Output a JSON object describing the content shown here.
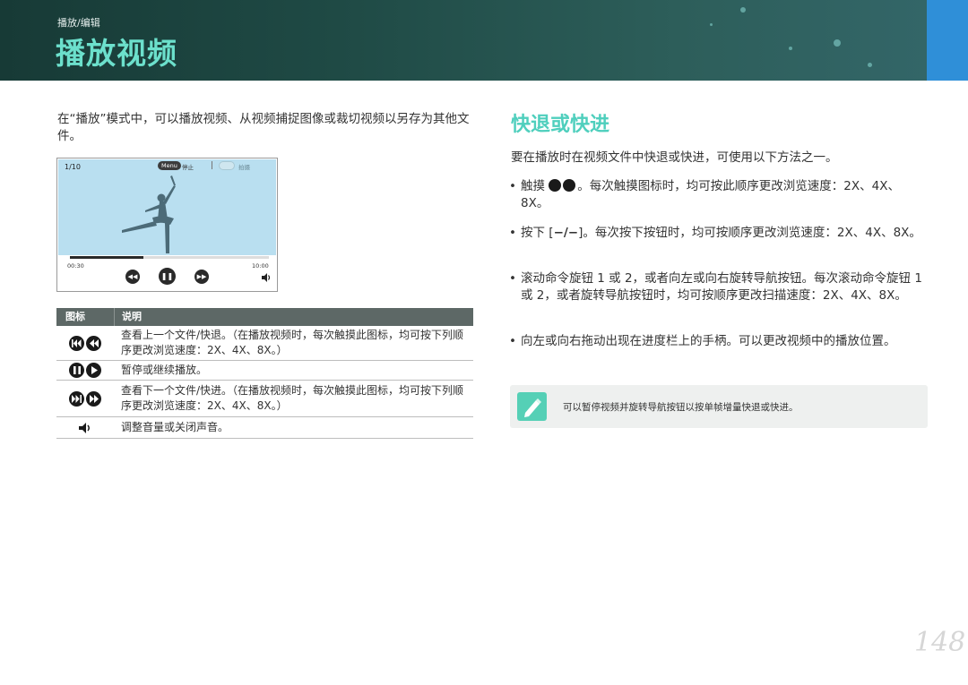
{
  "header": {
    "breadcrumb": "播放/编辑",
    "title": "播放视频"
  },
  "left": {
    "intro": "在“播放”模式中，可以播放视频、从视频捕捉图像或裁切视频以另存为其他文件。",
    "screen": {
      "counter": "1/10",
      "menu_label": "Menu",
      "stop_label": "停止",
      "capture_label": "拍摄",
      "time_start": "00:30",
      "time_end": "10:00",
      "progress": 0.37
    },
    "table": {
      "col_icon": "图标",
      "col_desc": "说明",
      "rows": [
        {
          "icons": [
            "skip-back-icon",
            "rewind-icon"
          ],
          "desc": "查看上一个文件/快退。（在播放视频时，每次触摸此图标，均可按下列顺序更改浏览速度：2X、4X、8X。）"
        },
        {
          "icons": [
            "pause-icon",
            "play-icon"
          ],
          "desc": "暂停或继续播放。"
        },
        {
          "icons": [
            "skip-forward-icon",
            "fast-forward-icon"
          ],
          "desc": "查看下一个文件/快进。（在播放视频时，每次触摸此图标，均可按下列顺序更改浏览速度：2X、4X、8X。）"
        },
        {
          "icons": [
            "volume-icon"
          ],
          "desc": "调整音量或关闭声音。"
        }
      ]
    }
  },
  "right": {
    "title": "快退或快进",
    "intro": "要在播放时在视频文件中快退或快进，可使用以下方法之一。",
    "bullets": [
      {
        "pre": "触摸",
        "post": "。每次触摸图标时，均可按此顺序更改浏览速度：2X、4X、8X。"
      },
      {
        "pre": "按下 [",
        "key": "−/−",
        "post": "]。每次按下按钮时，均可按顺序更改浏览速度：2X、4X、8X。"
      },
      {
        "text": "滚动命令旋钮 1 或 2，或者向左或向右旋转导航按钮。每次滚动命令旋钮 1 或 2，或者旋转导航按钮时，均可按顺序更改扫描速度：2X、4X、8X。"
      },
      {
        "text": "向左或向右拖动出现在进度栏上的手柄。可以更改视频中的播放位置。"
      }
    ],
    "note": "可以暂停视频并旋转导航按钮以按单帧增量快退或快进。"
  },
  "page_number": "148",
  "colors": {
    "title_teal": "#6ce0cc",
    "section_teal": "#4fcfbd",
    "side_tab_blue": "#2f8fd8",
    "table_header": "#5d6866"
  }
}
